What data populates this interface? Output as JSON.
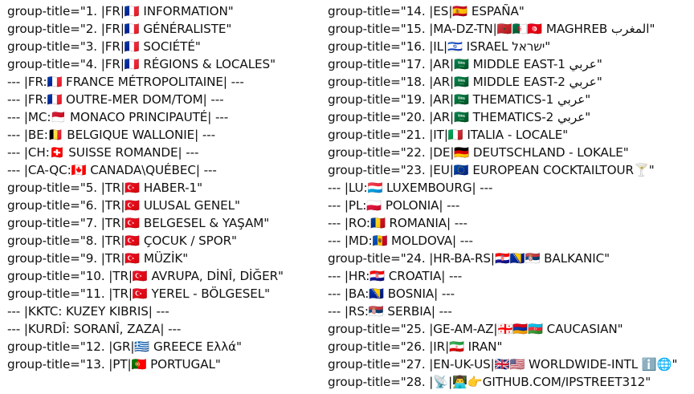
{
  "left_column": [
    "group-title=\"1. |FR|🇫🇷 INFORMATION\"",
    "group-title=\"2. |FR|🇫🇷 GÉNÉRALISTE\"",
    "group-title=\"3. |FR|🇫🇷 SOCIÉTÉ\"",
    "group-title=\"4. |FR|🇫🇷 RÉGIONS & LOCALES\"",
    "--- |FR:🇫🇷 FRANCE MÉTROPOLITAINE| ---",
    "--- |FR:🇫🇷 OUTRE-MER DOM/TOM| ---",
    "--- |MC:🇲🇨 MONACO PRINCIPAUTÉ| ---",
    "--- |BE:🇧🇪 BELGIQUE WALLONIE| ---",
    "--- |CH:🇨🇭 SUISSE ROMANDE| ---",
    "--- |CA-QC:🇨🇦 CANADA\\QUÉBEC| ---",
    "group-title=\"5. |TR|🇹🇷 HABER-1\"",
    "group-title=\"6. |TR|🇹🇷 ULUSAL GENEL\"",
    "group-title=\"7. |TR|🇹🇷 BELGESEL & YAŞAM\"",
    "group-title=\"8. |TR|🇹🇷 ÇOCUK / SPOR\"",
    "group-title=\"9. |TR|🇹🇷 MÜZİK\"",
    "group-title=\"10. |TR|🇹🇷 AVRUPA, DİNÎ, DİĞER\"",
    "group-title=\"11. |TR|🇹🇷 YEREL - BÖLGESEL\"",
    "--- |KKTC: KUZEY KIBRIS| ---",
    "--- |KURDÎ: SORANÎ, ZAZA| ---",
    "group-title=\"12. |GR|🇬🇷 GREECE Ελλά\"",
    "group-title=\"13. |PT|🇵🇹 PORTUGAL\""
  ],
  "right_column": [
    "group-title=\"14. |ES|🇪🇸 ESPAÑA\"",
    "group-title=\"15. |MA-DZ-TN|🇲🇦🇩🇿🇹🇳 MAGHREB المغرب\"",
    "group-title=\"16. |IL|🇮🇱 ISRAEL ישראל\"",
    "group-title=\"17. |AR|🇸🇦 MIDDLE EAST-1 عربي\"",
    "group-title=\"18. |AR|🇸🇦 MIDDLE EAST-2 عربي\"",
    "group-title=\"19. |AR|🇸🇦 THEMATICS-1 عربي\"",
    "group-title=\"20. |AR|🇸🇦 THEMATICS-2 عربي\"",
    "group-title=\"21. |IT|🇮🇹 ITALIA - LOCALE\"",
    "group-title=\"22. |DE|🇩🇪 DEUTSCHLAND - LOKALE\"",
    "group-title=\"23. |EU|🇪🇺 EUROPEAN COCKTAILTOUR🍸\"",
    "--- |LU:🇱🇺 LUXEMBOURG| ---",
    "--- |PL:🇵🇱 POLONIA| ---",
    "--- |RO:🇷🇴 ROMANIA| ---",
    "--- |MD:🇲🇩 MOLDOVA| ---",
    "group-title=\"24. |HR-BA-RS|🇭🇷🇧🇦🇷🇸 BALKANIC\"",
    "--- |HR:🇭🇷 CROATIA| ---",
    "--- |BA:🇧🇦 BOSNIA| ---",
    "--- |RS:🇷🇸 SERBIA| ---",
    "group-title=\"25. |GE-AM-AZ|🇬🇪🇦🇲🇦🇿 CAUCASIAN\"",
    "group-title=\"26. |IR|🇮🇷 IRAN\"",
    "group-title=\"27. |EN-UK-US|🇬🇧🇺🇸 WORLDWIDE-INTL ℹ️🌐\"",
    "group-title=\"28. |📡|👨‍💻👉GITHUB.COM/IPSTREET312\""
  ]
}
